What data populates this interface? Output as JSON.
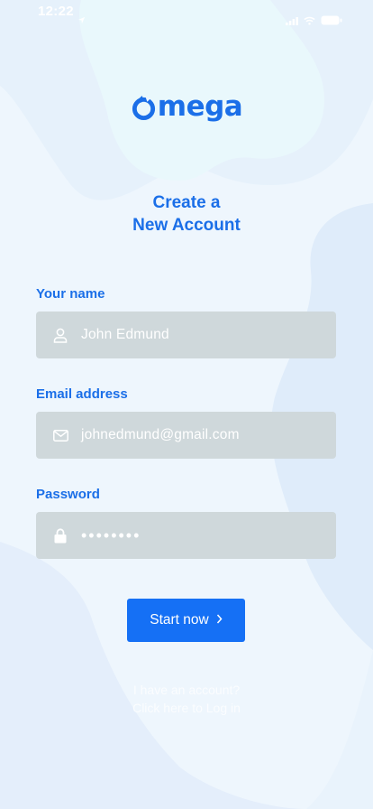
{
  "status_bar": {
    "time": "12:22"
  },
  "app": {
    "logo_text": "mega"
  },
  "title": {
    "line1": "Create a",
    "line2": "New Account"
  },
  "form": {
    "name": {
      "label": "Your name",
      "value": "John Edmund",
      "icon": "user-icon"
    },
    "email": {
      "label": "Email address",
      "value": "johnedmund@gmail.com",
      "icon": "mail-icon"
    },
    "password": {
      "label": "Password",
      "value": "••••••••",
      "icon": "lock-icon"
    }
  },
  "submit": {
    "label": "Start now",
    "icon": "chevron-right-icon"
  },
  "footer": {
    "line1": "I have an account?",
    "line2": "Click here to Log in"
  },
  "colors": {
    "brand": "#1b6fe8",
    "button": "#1570f5",
    "field_bg": "#cfd8db",
    "page_bg": "#eef6fd"
  }
}
